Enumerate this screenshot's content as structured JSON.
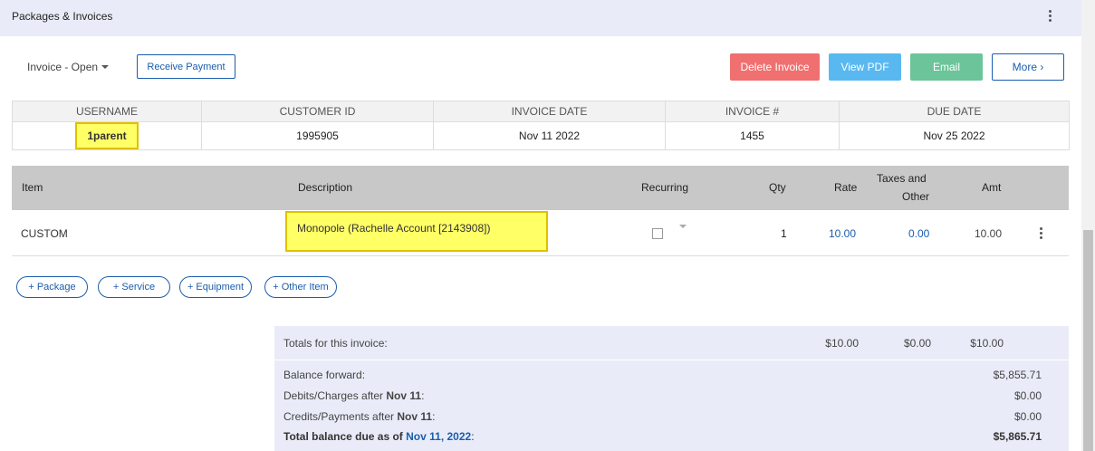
{
  "header": {
    "title": "Packages & Invoices"
  },
  "toolbar": {
    "status": "Invoice - Open",
    "receive_payment": "Receive Payment",
    "delete_invoice": "Delete Invoice",
    "view_pdf": "View PDF",
    "email": "Email",
    "more": "More ›"
  },
  "info": {
    "headers": [
      "USERNAME",
      "CUSTOMER ID",
      "INVOICE DATE",
      "INVOICE #",
      "DUE DATE"
    ],
    "values": [
      "1parent",
      "1995905",
      "Nov 11 2022",
      "1455",
      "Nov 25 2022"
    ]
  },
  "items": {
    "headers": {
      "item": "Item",
      "description": "Description",
      "recurring": "Recurring",
      "qty": "Qty",
      "rate": "Rate",
      "taxes_1": "Taxes and",
      "taxes_2": "Other",
      "amt": "Amt"
    },
    "rows": [
      {
        "item": "CUSTOM",
        "description": "Monopole (Rachelle Account [2143908])",
        "qty": "1",
        "rate": "10.00",
        "taxes": "0.00",
        "amt": "10.00"
      }
    ]
  },
  "add_buttons": [
    "+ Package",
    "+ Service",
    "+ Equipment",
    "+ Other Item"
  ],
  "totals": {
    "label": "Totals for this invoice:",
    "rate_total": "$10.00",
    "taxes_total": "$0.00",
    "amt_total": "$10.00",
    "balance_forward_label": "Balance forward:",
    "balance_forward": "$5,855.71",
    "debits_label": "Debits/Charges after ",
    "debits_date": "Nov 11",
    "debits": "$0.00",
    "credits_label": "Credits/Payments after ",
    "credits_date": "Nov 11",
    "credits": "$0.00",
    "total_due_label": "Total balance due as of ",
    "total_due_date": "Nov 11, 2022",
    "total_due": "$5,865.71"
  },
  "colors": {
    "accent": "#1a5dad",
    "delete": "#f07070",
    "view_pdf": "#5ab8f0",
    "email": "#6cc49a",
    "highlight": "#ffff66"
  }
}
